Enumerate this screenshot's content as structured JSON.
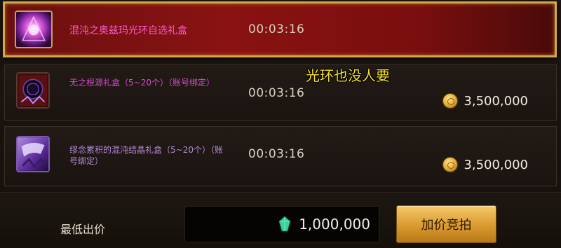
{
  "items": [
    {
      "name": "混沌之奥兹玛光环自选礼盒",
      "timer": "00:03:16",
      "price": "",
      "icon": "purple-aura-box-icon"
    },
    {
      "name": "无之根源礼盒（5~20个）（账号绑定）",
      "timer": "00:03:16",
      "price": "3,500,000",
      "icon": "void-orb-box-icon"
    },
    {
      "name": "缪念累积的混沌结晶礼盒（5~20个）（账号绑定）",
      "timer": "00:03:16",
      "price": "3,500,000",
      "icon": "chaos-crystal-box-icon"
    }
  ],
  "overlay_comment": "光环也没人要",
  "bottom": {
    "label": "最低出价",
    "bid_value": "1,000,000",
    "button_label": "加价竞拍"
  },
  "colors": {
    "selected_border": "#d8a64a",
    "selected_bg": "#8a1212",
    "item_name": "#d44cc8",
    "button": "#e0a030",
    "overlay_text": "#f2e02a"
  }
}
